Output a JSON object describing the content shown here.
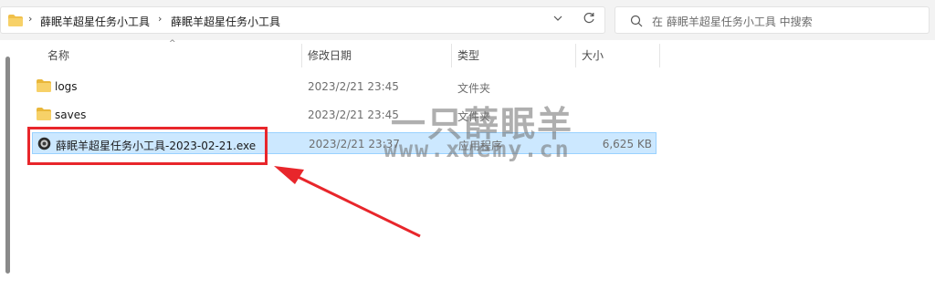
{
  "address_bar": {
    "crumbs": [
      "薛眠羊超星任务小工具",
      "薛眠羊超星任务小工具"
    ],
    "separator": "›"
  },
  "search": {
    "placeholder": "在 薛眠羊超星任务小工具 中搜索"
  },
  "columns": {
    "name": "名称",
    "date": "修改日期",
    "type": "类型",
    "size": "大小"
  },
  "files": [
    {
      "name": "logs",
      "date": "2023/2/21 23:45",
      "type": "文件夹",
      "size": "",
      "icon": "folder-icon",
      "selected": false
    },
    {
      "name": "saves",
      "date": "2023/2/21 23:45",
      "type": "文件夹",
      "size": "",
      "icon": "folder-icon",
      "selected": false
    },
    {
      "name": "薛眠羊超星任务小工具-2023-02-21.exe",
      "date": "2023/2/21 23:37",
      "type": "应用程序",
      "size": "6,625 KB",
      "icon": "app-exe-icon",
      "selected": true
    }
  ],
  "watermark": {
    "line1": "一只薛眠羊",
    "line2": "www.xuemy.cn"
  },
  "colors": {
    "highlight": "#e8262b",
    "selection": "#cce8ff",
    "folder": "#f0c04a"
  }
}
